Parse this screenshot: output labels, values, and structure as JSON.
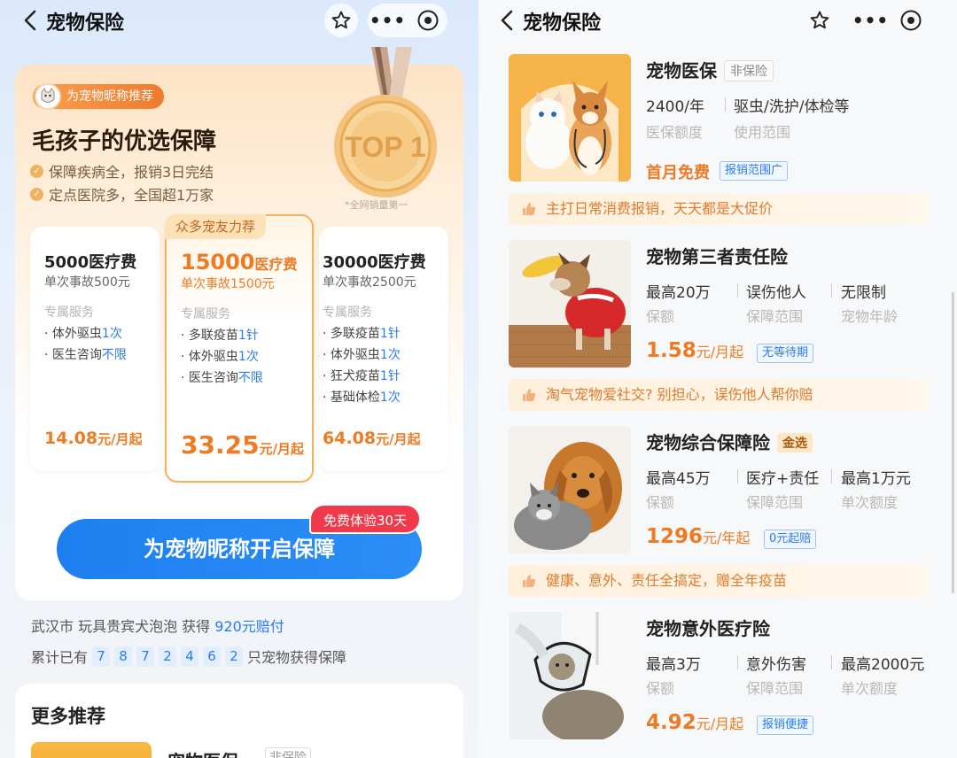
{
  "left": {
    "nav": {
      "title": "宠物保险",
      "more": "•••"
    },
    "hero": {
      "tag": "为宠物昵称推荐",
      "title": "毛孩子的优选保障",
      "bullets": [
        "保障疾病全，报销3日完结",
        "定点医院多，全国超1万家"
      ],
      "medal_text": "TOP 1",
      "medal_caption": "*全网销量第一",
      "service_label": "专属服务",
      "plans": [
        {
          "amount": "5000医疗费",
          "sub": "单次事故500元",
          "items": [
            {
              "k": "体外驱虫",
              "v": "1次"
            },
            {
              "k": "医生咨询",
              "v": "不限"
            }
          ],
          "price": "14.08",
          "unit": "元/月起"
        },
        {
          "recommend": "众多宠友力荐",
          "amount": "15000",
          "amount_unit": "医疗费",
          "sub": "单次事故1500元",
          "items": [
            {
              "k": "多联疫苗",
              "v": "1针"
            },
            {
              "k": "体外驱虫",
              "v": "1次"
            },
            {
              "k": "医生咨询",
              "v": "不限"
            }
          ],
          "price": "33.25",
          "unit": "元/月起"
        },
        {
          "amount": "30000医疗费",
          "sub": "单次事故2500元",
          "items": [
            {
              "k": "多联疫苗",
              "v": "1针"
            },
            {
              "k": "体外驱虫",
              "v": "1次"
            },
            {
              "k": "狂犬疫苗",
              "v": "1针"
            },
            {
              "k": "基础体检",
              "v": "1次"
            }
          ],
          "price": "64.08",
          "unit": "元/月起"
        }
      ],
      "cta": "为宠物昵称开启保障",
      "cta_badge": "免费体验30天"
    },
    "claim": {
      "prefix": "武汉市 玩具贵宾犬泡泡 获得 ",
      "amount": "920元赔付"
    },
    "count": {
      "prefix": "累计已有",
      "digits": [
        "7",
        "8",
        "7",
        "2",
        "4",
        "6",
        "2"
      ],
      "suffix": "只宠物获得保障"
    },
    "more": {
      "heading": "更多推荐",
      "product": "宠物医保",
      "badge": "非保险"
    }
  },
  "right": {
    "nav": {
      "title": "宠物保险",
      "more": "•••"
    },
    "products": [
      {
        "name": "宠物医保",
        "badge": "非保险",
        "badge_style": "gray",
        "fields": [
          {
            "v": "2400/年",
            "l": "医保额度"
          },
          {
            "v": "驱虫/洗护/体检等",
            "l": "使用范围"
          }
        ],
        "price": "首月免费",
        "price_unit": "",
        "chip": "报销范围广",
        "bar": "主打日常消费报销，天天都是大促价"
      },
      {
        "name": "宠物第三者责任险",
        "badge": "",
        "badge_style": "",
        "fields": [
          {
            "v": "最高20万",
            "l": "保额"
          },
          {
            "v": "误伤他人",
            "l": "保障范围"
          },
          {
            "v": "无限制",
            "l": "宠物年龄"
          }
        ],
        "price": "1.58",
        "price_unit": "元/月起",
        "chip": "无等待期",
        "bar": "淘气宠物爱社交? 别担心，误伤他人帮你赔"
      },
      {
        "name": "宠物综合保障险",
        "badge": "金选",
        "badge_style": "gold",
        "fields": [
          {
            "v": "最高45万",
            "l": "保额"
          },
          {
            "v": "医疗+责任",
            "l": "保障范围"
          },
          {
            "v": "最高1万元",
            "l": "单次额度"
          }
        ],
        "price": "1296",
        "price_unit": "元/年起",
        "chip": "0元起赔",
        "bar": "健康、意外、责任全搞定，赠全年疫苗"
      },
      {
        "name": "宠物意外医疗险",
        "badge": "",
        "badge_style": "",
        "fields": [
          {
            "v": "最高3万",
            "l": "保额"
          },
          {
            "v": "意外伤害",
            "l": "保障范围"
          },
          {
            "v": "最高2000元",
            "l": "单次额度"
          }
        ],
        "price": "4.92",
        "price_unit": "元/月起",
        "chip": "报销便捷",
        "bar": ""
      }
    ]
  },
  "colors": {
    "accent_orange": "#ee7b24",
    "accent_blue": "#2b7bf0",
    "badge_red": "#f1394b"
  },
  "icons": [
    "back-icon",
    "star-icon",
    "more-icon",
    "target-icon",
    "check-icon",
    "cat-avatar-icon",
    "thumbs-up-icon"
  ]
}
